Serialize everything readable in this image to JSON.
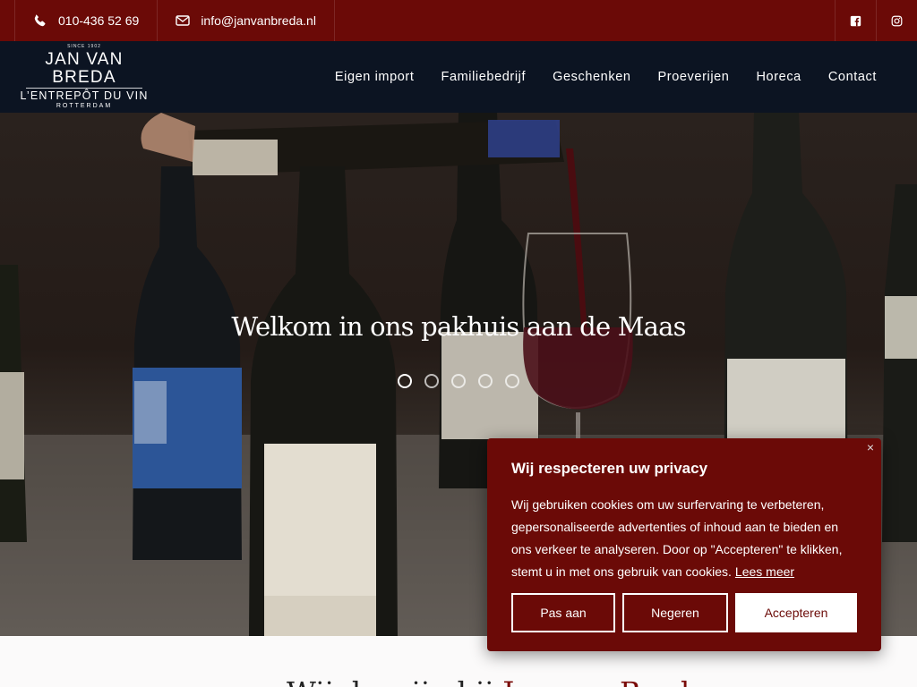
{
  "topbar": {
    "phone": "010-436 52 69",
    "email": "info@janvanbreda.nl",
    "icons": [
      "phone-icon",
      "envelope-icon",
      "facebook-icon",
      "instagram-icon"
    ]
  },
  "logo": {
    "since": "SINCE 1902",
    "name": "JAN VAN BREDA",
    "subtitle": "L’ENTREPÔT DU VIN",
    "city": "ROTTERDAM"
  },
  "nav": {
    "items": [
      "Eigen import",
      "Familiebedrijf",
      "Geschenken",
      "Proeverijen",
      "Horeca",
      "Contact"
    ]
  },
  "hero": {
    "title": "Welkom in ons pakhuis aan de Maas",
    "slides": 5,
    "active_slide": 1
  },
  "section": {
    "heading_start": "Wij de wijn bij ",
    "heading_accent": "Jan van Breda"
  },
  "cookie": {
    "title": "Wij respecteren uw privacy",
    "body": "Wij gebruiken cookies om uw surfervaring te verbeteren, gepersonaliseerde advertenties of inhoud aan te bieden en ons verkeer te analyseren. Door op \"Accepteren\" te klikken, stemt u in met ons gebruik van cookies.",
    "link": "Lees meer",
    "close": "×",
    "buttons": {
      "customize": "Pas aan",
      "reject": "Negeren",
      "accept": "Accepteren"
    }
  },
  "colors": {
    "brand_red": "#6b0a07",
    "nav_dark": "#0c1422"
  }
}
